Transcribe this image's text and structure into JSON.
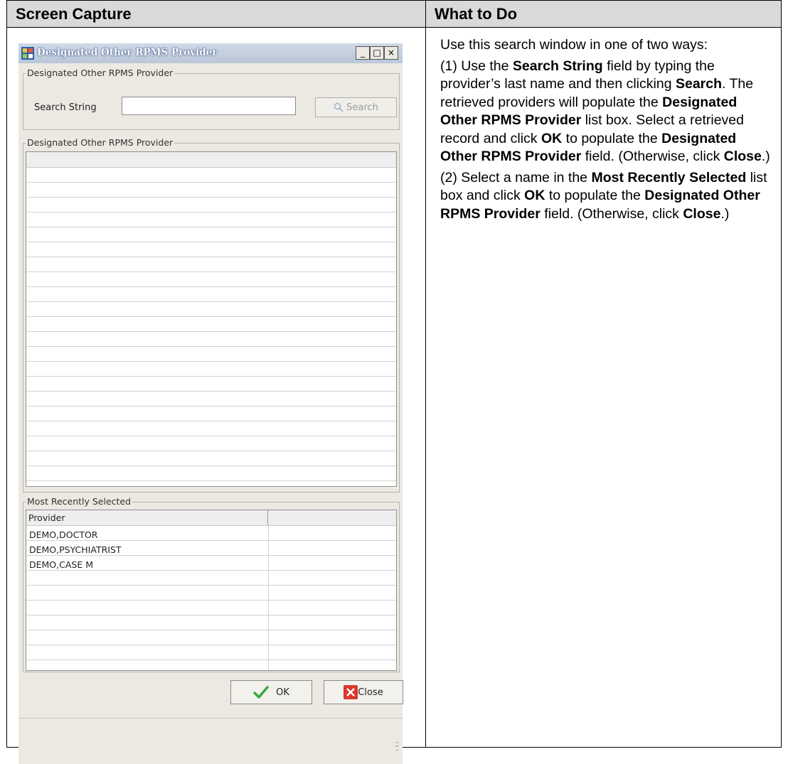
{
  "table": {
    "header_left": "Screen Capture",
    "header_right": "What to Do"
  },
  "dialog": {
    "title": "Designated Other RPMS Provider",
    "window_buttons": {
      "minimize": "_",
      "maximize": "□",
      "close": "×"
    },
    "search_group_label": "Designated Other RPMS Provider",
    "search_label": "Search String",
    "search_value": "",
    "search_button": "Search",
    "results_group_label": "Designated Other RPMS Provider",
    "recent_group_label": "Most Recently Selected",
    "recent_column": "Provider",
    "recent_items": [
      "DEMO,DOCTOR",
      "DEMO,PSYCHIATRIST",
      "DEMO,CASE M"
    ],
    "ok_button": "OK",
    "close_button": "Close"
  },
  "instructions": {
    "intro": "Use this search window in one of two ways:",
    "p1": {
      "a": "(1) Use the ",
      "b1": "Search String",
      "c": " field by typing the provider’s last name and then clicking ",
      "b2": "Search",
      "d": ". The retrieved providers will populate the ",
      "b3": "Designated Other RPMS Provider",
      "e": " list box. Select a retrieved record and click ",
      "b4": "OK",
      "f": " to populate the ",
      "b5": "Designated Other RPMS Provider",
      "g": " field. (Otherwise, click ",
      "b6": "Close",
      "h": ".)"
    },
    "p2": {
      "a": "(2) Select a name in the ",
      "b1": "Most Recently Selected",
      "c": " list box and click ",
      "b2": "OK",
      "d": " to populate the ",
      "b3": "Designated Other RPMS Provider",
      "e": " field. (Otherwise, click ",
      "b4": "Close",
      "f": ".)"
    }
  }
}
